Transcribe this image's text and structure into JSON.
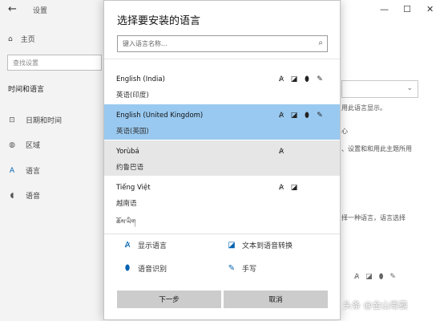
{
  "background": {
    "title": "设置",
    "back_glyph": "←",
    "window_controls": [
      "—",
      "☐",
      "✕"
    ],
    "home_label": "主页",
    "search_placeholder": "查找设置",
    "section_heading": "时间和语言",
    "sidebar_items": [
      {
        "label": "日期和时间",
        "icon": "calendar-icon",
        "glyph": "⊡"
      },
      {
        "label": "区域",
        "icon": "globe-icon",
        "glyph": "◍"
      },
      {
        "label": "语言",
        "icon": "language-icon",
        "glyph": "A"
      },
      {
        "label": "语音",
        "icon": "mic-icon",
        "glyph": "◖"
      }
    ],
    "text_fragments": [
      "用此语言显示。",
      "心",
      "、设置和和用此主题所用",
      "择一种语言，语言选择"
    ]
  },
  "dialog": {
    "title": "选择要安装的语言",
    "search_placeholder": "键入语言名称...",
    "languages": [
      {
        "name": "English (India)",
        "native": "英语(印度)",
        "features": [
          "display",
          "tts",
          "speech",
          "handwriting"
        ],
        "state": "normal"
      },
      {
        "name": "English (United Kingdom)",
        "native": "英语(英国)",
        "features": [
          "display",
          "tts",
          "speech",
          "handwriting"
        ],
        "state": "selected"
      },
      {
        "name": "Yorùbá",
        "native": "约鲁巴语",
        "features": [
          "display"
        ],
        "state": "hover"
      },
      {
        "name": "Tiếng Việt",
        "native": "越南语",
        "features": [
          "display",
          "tts"
        ],
        "state": "normal"
      }
    ],
    "partial_next_row": "ཆོས་ཡིག",
    "legend": {
      "display": "显示语言",
      "tts": "文本到语音转换",
      "speech": "语音识别",
      "handwriting": "手写"
    },
    "buttons": {
      "next": "下一步",
      "cancel": "取消"
    }
  },
  "icons": {
    "display": "A̷",
    "tts": "◪",
    "speech": "⬮",
    "handwriting": "✎",
    "search": "⌕"
  },
  "watermark": "头条 @金山毒霸"
}
